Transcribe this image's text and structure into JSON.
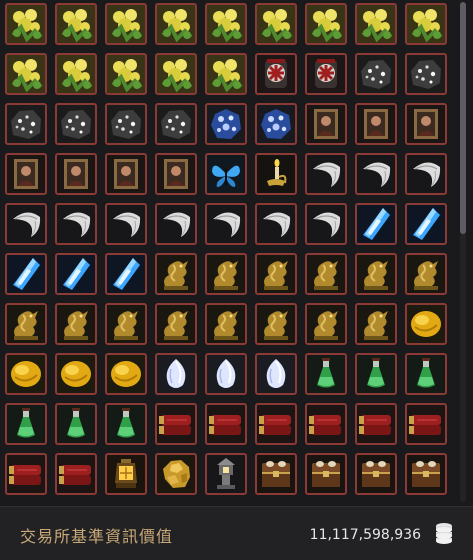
{
  "footer": {
    "label": "交易所基準資訊價值",
    "value": "11,117,598,936",
    "currency_icon": "silver-stack-icon"
  },
  "colors": {
    "slot_border": "#8c3a36",
    "slot_bg": "#1c1c1f",
    "panel_bg": "#1a1a1d",
    "label_gold": "#c9a978"
  },
  "inventory": {
    "columns": 9,
    "items": [
      "herb",
      "herb",
      "herb",
      "herb",
      "herb",
      "herb",
      "herb",
      "herb",
      "herb",
      "herb",
      "herb",
      "herb",
      "herb",
      "herb",
      "lantern-box",
      "lantern-box",
      "ore",
      "ore",
      "ore",
      "ore",
      "ore",
      "ore",
      "blue-stone",
      "blue-stone",
      "portrait",
      "portrait",
      "portrait",
      "portrait",
      "portrait",
      "portrait",
      "portrait",
      "butterfly",
      "candle",
      "feather",
      "feather",
      "feather",
      "feather",
      "feather",
      "feather",
      "feather",
      "feather",
      "feather",
      "feather",
      "blue-crystal",
      "blue-crystal",
      "blue-crystal",
      "blue-crystal",
      "blue-crystal",
      "dragon",
      "dragon",
      "dragon",
      "dragon",
      "dragon",
      "dragon",
      "dragon",
      "dragon",
      "dragon",
      "dragon",
      "dragon",
      "dragon",
      "dragon",
      "dragon",
      "gold-stone",
      "gold-stone",
      "gold-stone",
      "gold-stone",
      "white-gem",
      "white-gem",
      "white-gem",
      "potion",
      "potion",
      "potion",
      "potion",
      "potion",
      "potion",
      "scroll",
      "scroll",
      "scroll",
      "scroll",
      "scroll",
      "scroll",
      "scroll",
      "scroll",
      "lamp",
      "gold-nugget",
      "stone-lantern",
      "chest",
      "chest",
      "chest",
      "chest"
    ]
  }
}
